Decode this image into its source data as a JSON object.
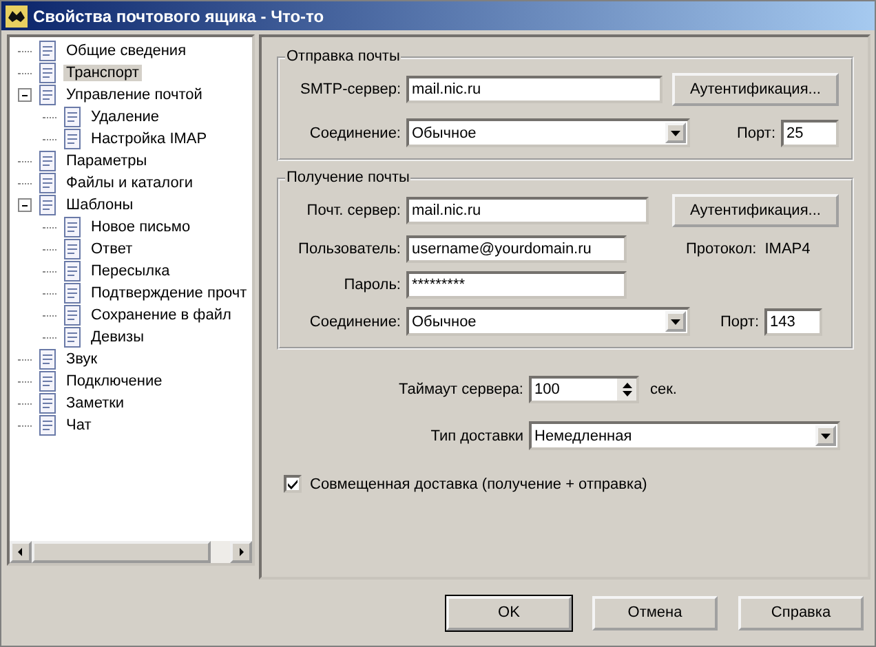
{
  "window": {
    "title": "Свойства почтового ящика - Что-то"
  },
  "tree": [
    {
      "label": "Общие сведения",
      "selected": false
    },
    {
      "label": "Транспорт",
      "selected": true
    },
    {
      "label": "Управление почтой",
      "selected": false,
      "expanded": true,
      "children": [
        {
          "label": "Удаление",
          "selected": false
        },
        {
          "label": "Настройка IMAP",
          "selected": false
        }
      ]
    },
    {
      "label": "Параметры",
      "selected": false
    },
    {
      "label": "Файлы и каталоги",
      "selected": false
    },
    {
      "label": "Шаблоны",
      "selected": false,
      "expanded": true,
      "children": [
        {
          "label": "Новое письмо",
          "selected": false
        },
        {
          "label": "Ответ",
          "selected": false
        },
        {
          "label": "Пересылка",
          "selected": false
        },
        {
          "label": "Подтверждение прочт",
          "selected": false
        },
        {
          "label": "Сохранение в файл",
          "selected": false
        },
        {
          "label": "Девизы",
          "selected": false
        }
      ]
    },
    {
      "label": "Звук",
      "selected": false
    },
    {
      "label": "Подключение",
      "selected": false
    },
    {
      "label": "Заметки",
      "selected": false
    },
    {
      "label": "Чат",
      "selected": false
    }
  ],
  "sending": {
    "title": "Отправка почты",
    "server_label": "SMTP-сервер:",
    "server": "mail.nic.ru",
    "auth_button": "Аутентификация...",
    "connection_label": "Соединение:",
    "connection": "Обычное",
    "port_label": "Порт:",
    "port": "25"
  },
  "receiving": {
    "title": "Получение почты",
    "server_label": "Почт. сервер:",
    "server": "mail.nic.ru",
    "auth_button": "Аутентификация...",
    "user_label": "Пользователь:",
    "user": "username@yourdomain.ru",
    "protocol_label": "Протокол:",
    "protocol": "IMAP4",
    "password_label": "Пароль:",
    "password": "*********",
    "connection_label": "Соединение:",
    "connection": "Обычное",
    "port_label": "Порт:",
    "port": "143"
  },
  "timeout": {
    "label": "Таймаут сервера:",
    "value": "100",
    "unit": "сек."
  },
  "delivery": {
    "label": "Тип доставки",
    "value": "Немедленная"
  },
  "combined": {
    "label": "Совмещенная доставка (получение + отправка)",
    "checked": true
  },
  "buttons": [
    "OK",
    "Отмена",
    "Справка"
  ]
}
